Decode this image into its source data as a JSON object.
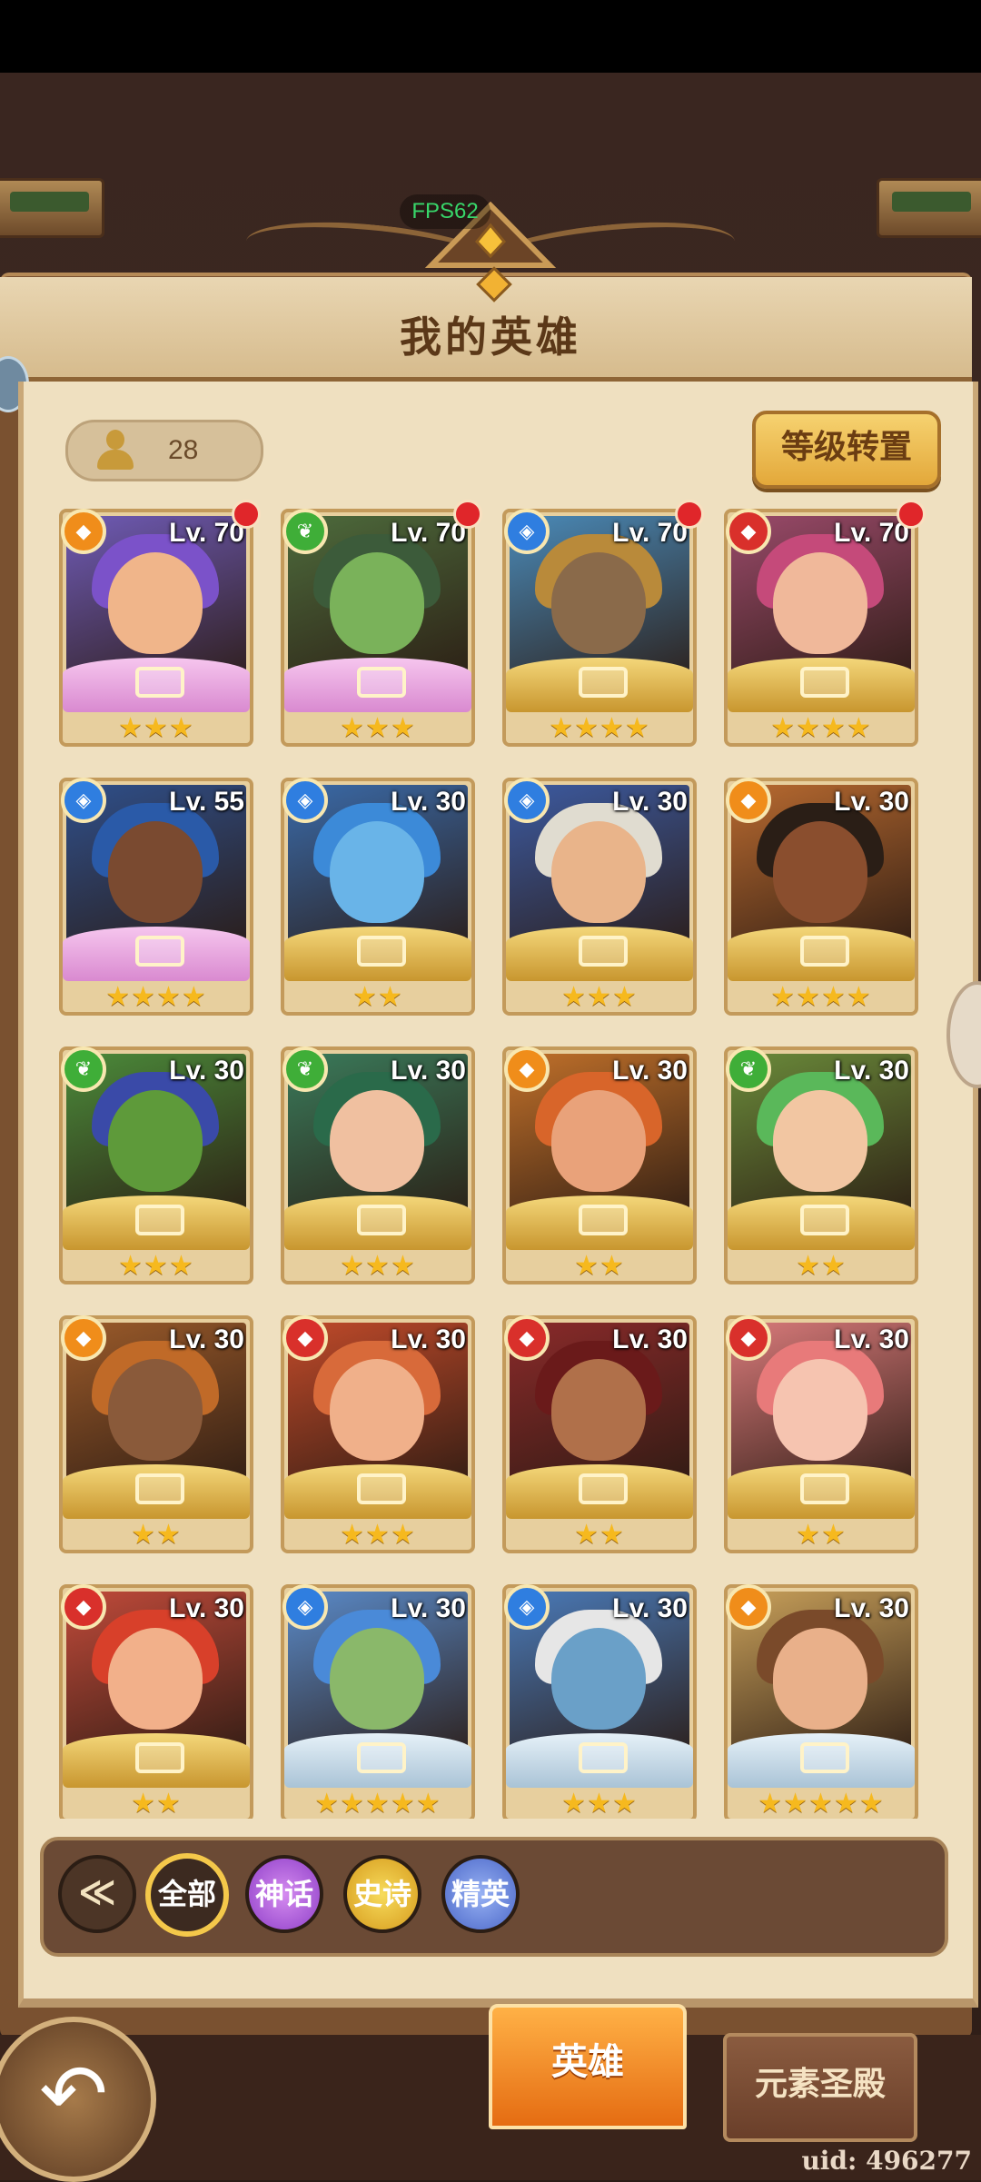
{
  "fps": "FPS62",
  "page_title": "我的英雄",
  "hero_count": "28",
  "level_transfer_label": "等级转置",
  "heroes": [
    {
      "level": "Lv. 70",
      "element": "earth",
      "stars": "★★★",
      "frame": "pink",
      "hair": "#7b52c9",
      "skin": "#f0b58a",
      "bg": "#6f5bb6",
      "dot": true
    },
    {
      "level": "Lv. 70",
      "element": "nature",
      "stars": "★★★",
      "frame": "pink",
      "hair": "#3c5b3a",
      "skin": "#7ab25a",
      "bg": "#4d6b3c",
      "dot": true
    },
    {
      "level": "Lv. 70",
      "element": "water",
      "stars": "★★★★",
      "frame": "gold",
      "hair": "#b98a3a",
      "skin": "#8a6a4a",
      "bg": "#4a8ab8",
      "dot": true
    },
    {
      "level": "Lv. 70",
      "element": "fire",
      "stars": "★★★★",
      "frame": "gold",
      "hair": "#c54a7a",
      "skin": "#f0b89a",
      "bg": "#9a4a6a",
      "dot": true
    },
    {
      "level": "Lv. 55",
      "element": "water",
      "stars": "★★★★",
      "frame": "pink",
      "hair": "#2a5aa8",
      "skin": "#7a4a30",
      "bg": "#2f4f8a",
      "dot": false
    },
    {
      "level": "Lv. 30",
      "element": "water",
      "stars": "★★",
      "frame": "gold",
      "hair": "#3c8ad8",
      "skin": "#69b4e8",
      "bg": "#3a6aa8",
      "dot": false
    },
    {
      "level": "Lv. 30",
      "element": "water",
      "stars": "★★★",
      "frame": "gold",
      "hair": "#e0dcd0",
      "skin": "#e9b48a",
      "bg": "#3c5aa0",
      "dot": false
    },
    {
      "level": "Lv. 30",
      "element": "earth",
      "stars": "★★★★",
      "frame": "gold",
      "hair": "#2a1e16",
      "skin": "#8a4e2e",
      "bg": "#b86a30",
      "dot": false
    },
    {
      "level": "Lv. 30",
      "element": "nature",
      "stars": "★★★",
      "frame": "gold",
      "hair": "#3a4aa8",
      "skin": "#5e9a3a",
      "bg": "#4b8a3a",
      "dot": false
    },
    {
      "level": "Lv. 30",
      "element": "nature",
      "stars": "★★★",
      "frame": "gold",
      "hair": "#2a6a4a",
      "skin": "#f0c0a0",
      "bg": "#3a7a5a",
      "dot": false
    },
    {
      "level": "Lv. 30",
      "element": "earth",
      "stars": "★★",
      "frame": "gold",
      "hair": "#d8652a",
      "skin": "#e9a27a",
      "bg": "#c0702a",
      "dot": false
    },
    {
      "level": "Lv. 30",
      "element": "nature",
      "stars": "★★",
      "frame": "gold",
      "hair": "#5ab85a",
      "skin": "#f2c6a2",
      "bg": "#6a8a3a",
      "dot": false
    },
    {
      "level": "Lv. 30",
      "element": "earth",
      "stars": "★★",
      "frame": "gold",
      "hair": "#c06a28",
      "skin": "#8a5a3a",
      "bg": "#9a5a2a",
      "dot": false
    },
    {
      "level": "Lv. 30",
      "element": "fire",
      "stars": "★★★",
      "frame": "gold",
      "hair": "#d86a3a",
      "skin": "#f0b08a",
      "bg": "#c04a2a",
      "dot": false
    },
    {
      "level": "Lv. 30",
      "element": "fire",
      "stars": "★★",
      "frame": "gold",
      "hair": "#6a1a1a",
      "skin": "#b0704a",
      "bg": "#8a2a2a",
      "dot": false
    },
    {
      "level": "Lv. 30",
      "element": "fire",
      "stars": "★★",
      "frame": "gold",
      "hair": "#e87a7a",
      "skin": "#f6c4b0",
      "bg": "#d87a7a",
      "dot": false
    },
    {
      "level": "Lv. 30",
      "element": "fire",
      "stars": "★★",
      "frame": "gold",
      "hair": "#d8402a",
      "skin": "#f2b08a",
      "bg": "#c04a3a",
      "dot": false
    },
    {
      "level": "Lv. 30",
      "element": "water",
      "stars": "★★★★★",
      "frame": "blue",
      "hair": "#4a8ad8",
      "skin": "#8ab86a",
      "bg": "#5a8ac8",
      "dot": false
    },
    {
      "level": "Lv. 30",
      "element": "water",
      "stars": "★★★",
      "frame": "blue",
      "hair": "#e6e6e6",
      "skin": "#6aa0c8",
      "bg": "#4a7ab8",
      "dot": false
    },
    {
      "level": "Lv. 30",
      "element": "earth",
      "stars": "★★★★★",
      "frame": "blue",
      "hair": "#7a4a2a",
      "skin": "#e9b08a",
      "bg": "#c8a05a",
      "dot": false
    }
  ],
  "filters": {
    "collapse": "≪",
    "all": "全部",
    "myth": "神话",
    "epic": "史诗",
    "elite": "精英"
  },
  "bottom_nav": {
    "back": "↶",
    "heroes": "英雄",
    "temple": "元素圣殿"
  },
  "uid": "uid: 496277",
  "element_glyphs": {
    "earth": "◆",
    "nature": "❦",
    "water": "◈",
    "fire": "◆"
  }
}
